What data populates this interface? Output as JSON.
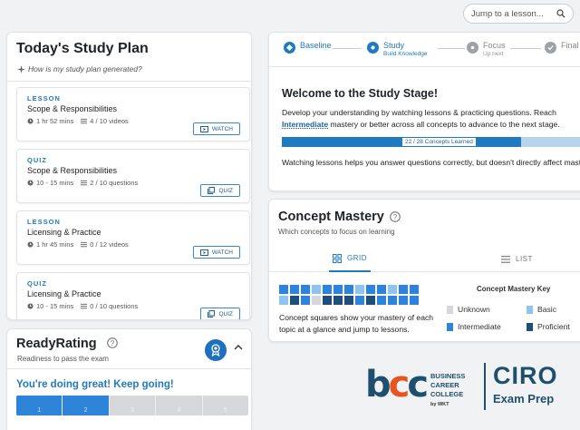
{
  "search": {
    "placeholder": "Jump to a lesson..."
  },
  "study_plan": {
    "title": "Today's Study Plan",
    "subtitle": "How is my study plan generated?",
    "items": [
      {
        "kind": "LESSON",
        "title": "Scope & Responsibilities",
        "duration": "1 hr 52 mins",
        "progress": "4 / 10 videos",
        "action": "WATCH"
      },
      {
        "kind": "QUIZ",
        "title": "Scope & Responsibilities",
        "duration": "10 - 15 mins",
        "progress": "2 / 10 questions",
        "action": "QUIZ"
      },
      {
        "kind": "LESSON",
        "title": "Licensing & Practice",
        "duration": "1 hr 45 mins",
        "progress": "0 / 12 videos",
        "action": "WATCH"
      },
      {
        "kind": "QUIZ",
        "title": "Licensing & Practice",
        "duration": "10 - 15 mins",
        "progress": "0 / 10 questions",
        "action": "QUIZ"
      }
    ]
  },
  "ready_rating": {
    "title": "ReadyRating",
    "subtitle": "Readiness to pass the exam",
    "message": "You're doing great! Keep going!",
    "segments": [
      "1",
      "2",
      "3",
      "4",
      "5"
    ],
    "level": 2
  },
  "stepper": {
    "steps": [
      {
        "label": "Baseline",
        "sub": "",
        "state": "done"
      },
      {
        "label": "Study",
        "sub": "Build Knowledge",
        "state": "current"
      },
      {
        "label": "Focus",
        "sub": "Up next",
        "state": "future"
      },
      {
        "label": "Final",
        "sub": "",
        "state": "future"
      }
    ]
  },
  "welcome": {
    "title": "Welcome to the Study Stage!",
    "desc_before": "Develop your understanding by watching lessons & practicing questions. Reach ",
    "desc_keyword": "Intermediate",
    "desc_after": " mastery or better across all concepts to advance to the next stage.",
    "progress_label": "22 / 28 Concepts Learned",
    "learned": 22,
    "total": 28,
    "note": "Watching lessons helps you answer questions correctly, but doesn't directly affect mastery."
  },
  "concept_mastery": {
    "title": "Concept Mastery",
    "subtitle": "Which concepts to focus on learning",
    "tab_grid": "GRID",
    "tab_list": "LIST",
    "description": "Concept squares show your mastery of each topic at a glance and jump to lessons.",
    "key_title": "Concept Mastery Key",
    "key": [
      {
        "label": "Unknown",
        "color": "#d5d7da"
      },
      {
        "label": "Basic",
        "color": "#8ec5ee"
      },
      {
        "label": "Intermediate",
        "color": "#2d84d8"
      },
      {
        "label": "Proficient",
        "color": "#1d4f7a"
      }
    ],
    "squares": [
      "intermediate",
      "intermediate",
      "intermediate",
      "basic",
      "intermediate",
      "intermediate",
      "intermediate",
      "basic",
      "intermediate",
      "intermediate",
      "basic",
      "intermediate",
      "intermediate",
      "basic",
      "proficient",
      "intermediate",
      "unknown",
      "proficient",
      "proficient",
      "proficient",
      "intermediate",
      "proficient",
      "intermediate",
      "intermediate",
      "intermediate",
      "intermediate"
    ]
  },
  "logo": {
    "mark": "bcc",
    "line1": "BUSINESS",
    "line2": "CAREER",
    "line3": "COLLEGE",
    "byline": "by WKT",
    "brand": "CIRO",
    "product": "Exam Prep"
  },
  "colors": {
    "accent": "#1f7ac0",
    "brand_blue": "#1f4f6e",
    "brand_orange": "#e8541e"
  }
}
